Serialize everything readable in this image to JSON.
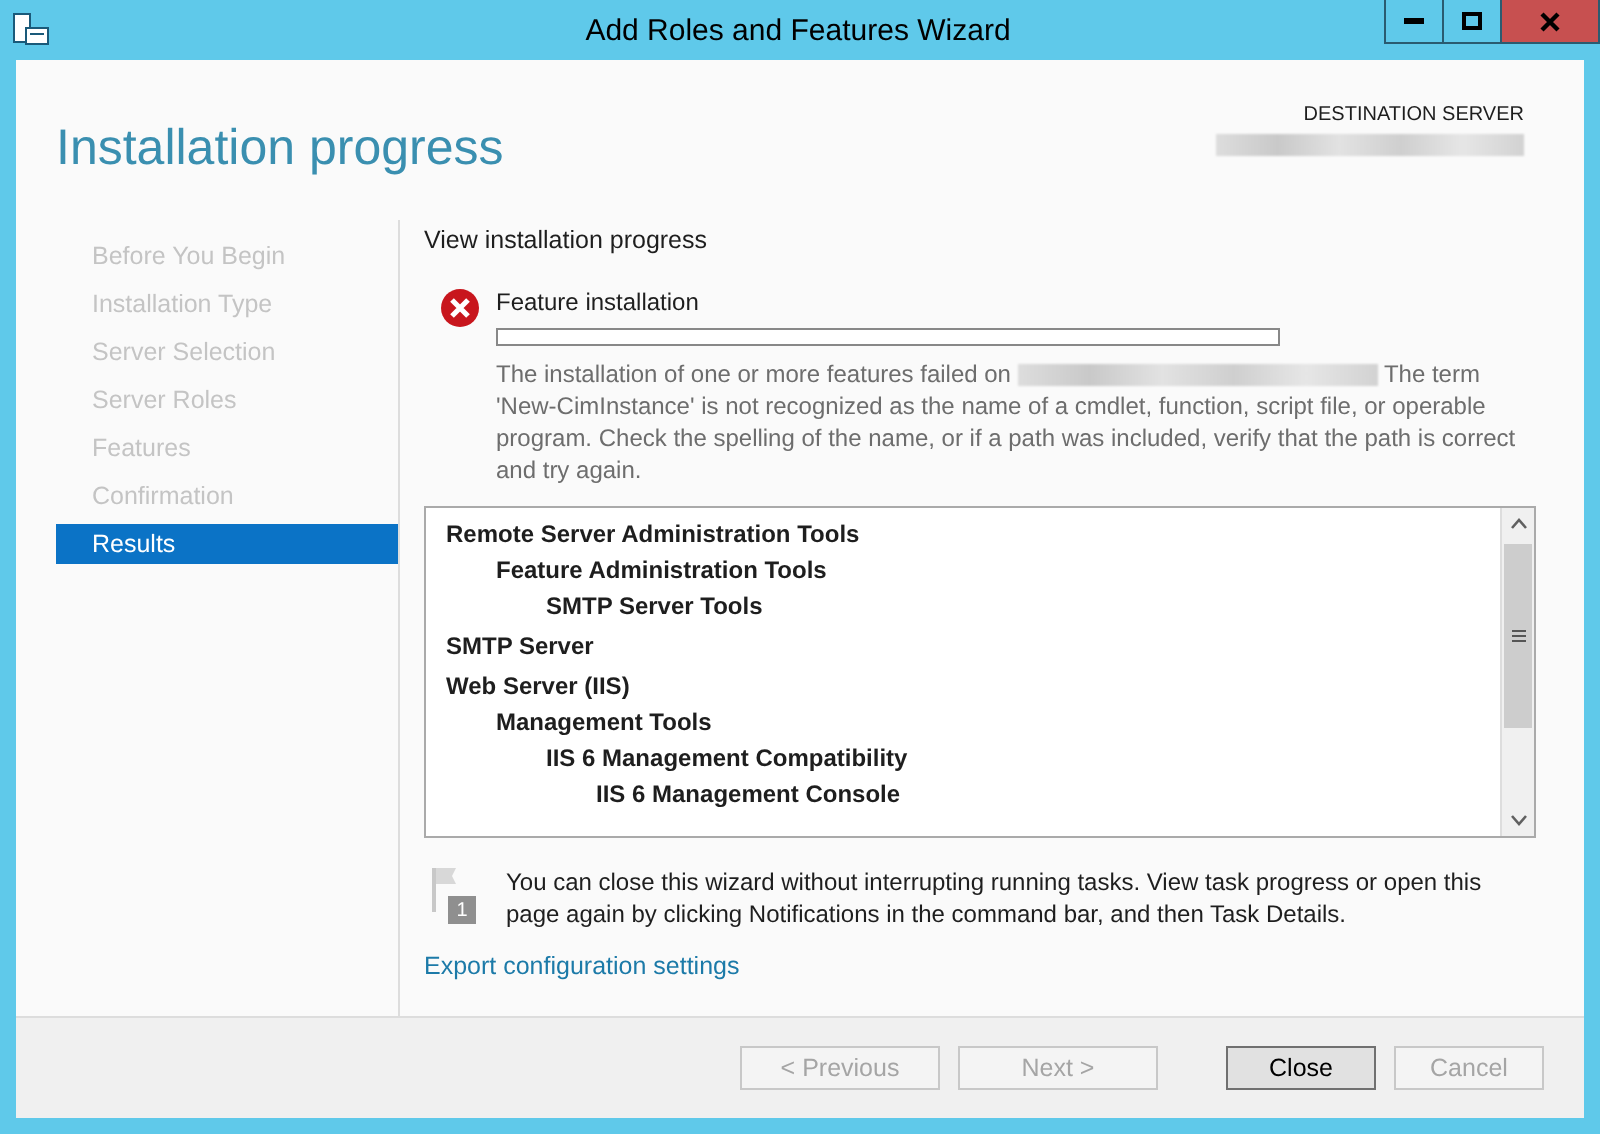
{
  "window": {
    "title": "Add Roles and Features Wizard"
  },
  "header": {
    "title": "Installation progress",
    "destination_label": "DESTINATION SERVER"
  },
  "steps": [
    {
      "label": "Before You Begin",
      "selected": false,
      "disabled": true
    },
    {
      "label": "Installation Type",
      "selected": false,
      "disabled": true
    },
    {
      "label": "Server Selection",
      "selected": false,
      "disabled": true
    },
    {
      "label": "Server Roles",
      "selected": false,
      "disabled": true
    },
    {
      "label": "Features",
      "selected": false,
      "disabled": true
    },
    {
      "label": "Confirmation",
      "selected": false,
      "disabled": true
    },
    {
      "label": "Results",
      "selected": true,
      "disabled": false
    }
  ],
  "content": {
    "heading": "View installation progress",
    "task": {
      "failed": true,
      "label": "Feature installation",
      "level": 0,
      "message_start": "The installation of one or more features failed on",
      "message_end": "The term 'New-CimInstance' is not recognized as the name of a cmdlet, function, script file, or operable program. Check the spelling of the name, or if a path was included, verify that the path is correct and try again."
    },
    "features": [
      {
        "label": "Remote Server Administration Tools",
        "children": [
          {
            "label": "Feature Administration Tools",
            "children": [
              {
                "label": "SMTP Server Tools"
              }
            ]
          }
        ]
      },
      {
        "label": "SMTP Server"
      },
      {
        "label": "Web Server (IIS)",
        "children": [
          {
            "label": "Management Tools",
            "children": [
              {
                "label": "IIS 6 Management Compatibility",
                "children": [
                  {
                    "label": "IIS 6 Management Console"
                  }
                ]
              }
            ]
          }
        ]
      }
    ],
    "notice": {
      "badge": "1",
      "text": "You can close this wizard without interrupting running tasks. View task progress or open this page again by clicking Notifications in the command bar, and then Task Details."
    },
    "export_link": "Export configuration settings"
  },
  "buttons": [
    {
      "label": "< Previous",
      "disabled": true,
      "default": false
    },
    {
      "label": "Next >",
      "disabled": true,
      "default": false
    },
    {
      "label": "Close",
      "disabled": false,
      "default": true
    },
    {
      "label": "Cancel",
      "disabled": true,
      "default": false
    }
  ]
}
